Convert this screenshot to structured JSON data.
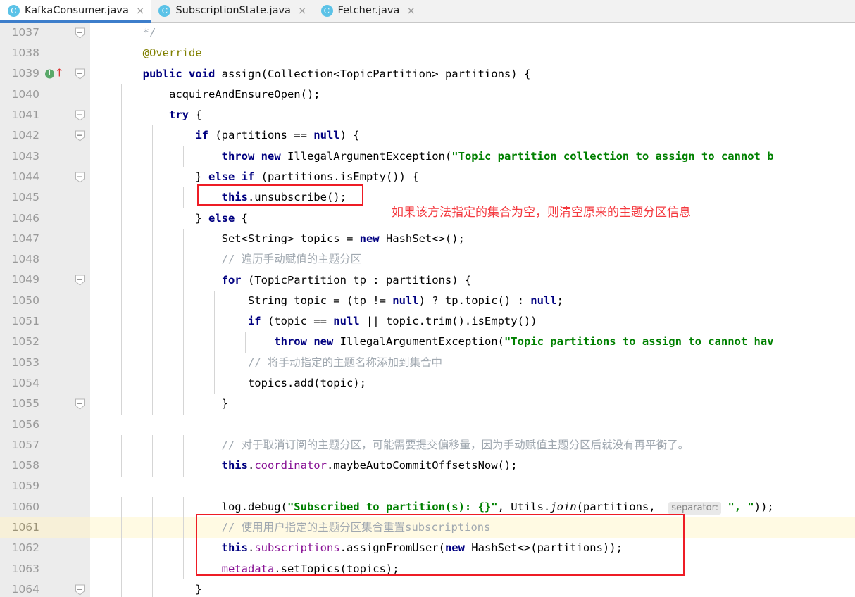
{
  "tabs": [
    {
      "label": "KafkaConsumer.java",
      "icon": "java-class-icon",
      "icon_letter": "C",
      "close": "×",
      "active": true
    },
    {
      "label": "SubscriptionState.java",
      "icon": "java-class-icon",
      "icon_letter": "C",
      "close": "×",
      "active": false
    },
    {
      "label": "Fetcher.java",
      "icon": "java-class-icon",
      "icon_letter": "C",
      "close": "×",
      "active": false
    }
  ],
  "editor": {
    "first_line": 1037,
    "caret_line": 1061,
    "gutter_markers": {
      "line": 1039,
      "implementation_icon_letter": "I",
      "override_arrow": "↑"
    },
    "fold_lines": [
      1037,
      1039,
      1041,
      1042,
      1044,
      1049,
      1055,
      1064
    ],
    "inline_hint": "separator:",
    "lines": [
      {
        "n": 1037,
        "text": "        */"
      },
      {
        "n": 1038,
        "text": "        @Override"
      },
      {
        "n": 1039,
        "text": "        public void assign(Collection<TopicPartition> partitions) {"
      },
      {
        "n": 1040,
        "text": "            acquireAndEnsureOpen();"
      },
      {
        "n": 1041,
        "text": "            try {"
      },
      {
        "n": 1042,
        "text": "                if (partitions == null) {"
      },
      {
        "n": 1043,
        "text": "                    throw new IllegalArgumentException(\"Topic partition collection to assign to cannot b"
      },
      {
        "n": 1044,
        "text": "                } else if (partitions.isEmpty()) {"
      },
      {
        "n": 1045,
        "text": "                    this.unsubscribe();"
      },
      {
        "n": 1046,
        "text": "                } else {"
      },
      {
        "n": 1047,
        "text": "                    Set<String> topics = new HashSet<>();"
      },
      {
        "n": 1048,
        "text": "                    // 遍历手动赋值的主题分区"
      },
      {
        "n": 1049,
        "text": "                    for (TopicPartition tp : partitions) {"
      },
      {
        "n": 1050,
        "text": "                        String topic = (tp != null) ? tp.topic() : null;"
      },
      {
        "n": 1051,
        "text": "                        if (topic == null || topic.trim().isEmpty())"
      },
      {
        "n": 1052,
        "text": "                            throw new IllegalArgumentException(\"Topic partitions to assign to cannot hav"
      },
      {
        "n": 1053,
        "text": "                        // 将手动指定的主题名称添加到集合中"
      },
      {
        "n": 1054,
        "text": "                        topics.add(topic);"
      },
      {
        "n": 1055,
        "text": "                    }"
      },
      {
        "n": 1056,
        "text": ""
      },
      {
        "n": 1057,
        "text": "                    // 对于取消订阅的主题分区，可能需要提交偏移量，因为手动赋值主题分区后就没有再平衡了。"
      },
      {
        "n": 1058,
        "text": "                    this.coordinator.maybeAutoCommitOffsetsNow();"
      },
      {
        "n": 1059,
        "text": ""
      },
      {
        "n": 1060,
        "text": "                    log.debug(\"Subscribed to partition(s): {}\", Utils.join(partitions,  separator: \", \"));"
      },
      {
        "n": 1061,
        "text": "                    // 使用用户指定的主题分区集合重置subscriptions"
      },
      {
        "n": 1062,
        "text": "                    this.subscriptions.assignFromUser(new HashSet<>(partitions));"
      },
      {
        "n": 1063,
        "text": "                    metadata.setTopics(topics);"
      },
      {
        "n": 1064,
        "text": "                }"
      }
    ]
  },
  "annotations": {
    "note_1": "如果该方法指定的集合为空，则清空原来的主题分区信息",
    "box_1_target": "this.unsubscribe();",
    "box_2_target": "subscriptions reset block"
  },
  "colors": {
    "keyword": "#000080",
    "string": "#008000",
    "comment": "#a0a8b0",
    "field": "#871094",
    "annotation": "#808000",
    "red_box": "#ee1c25",
    "red_text": "#f4393f",
    "caret_line": "#fffae3",
    "gutter": "#ececec",
    "tab_active_underline": "#3d7ecb"
  }
}
